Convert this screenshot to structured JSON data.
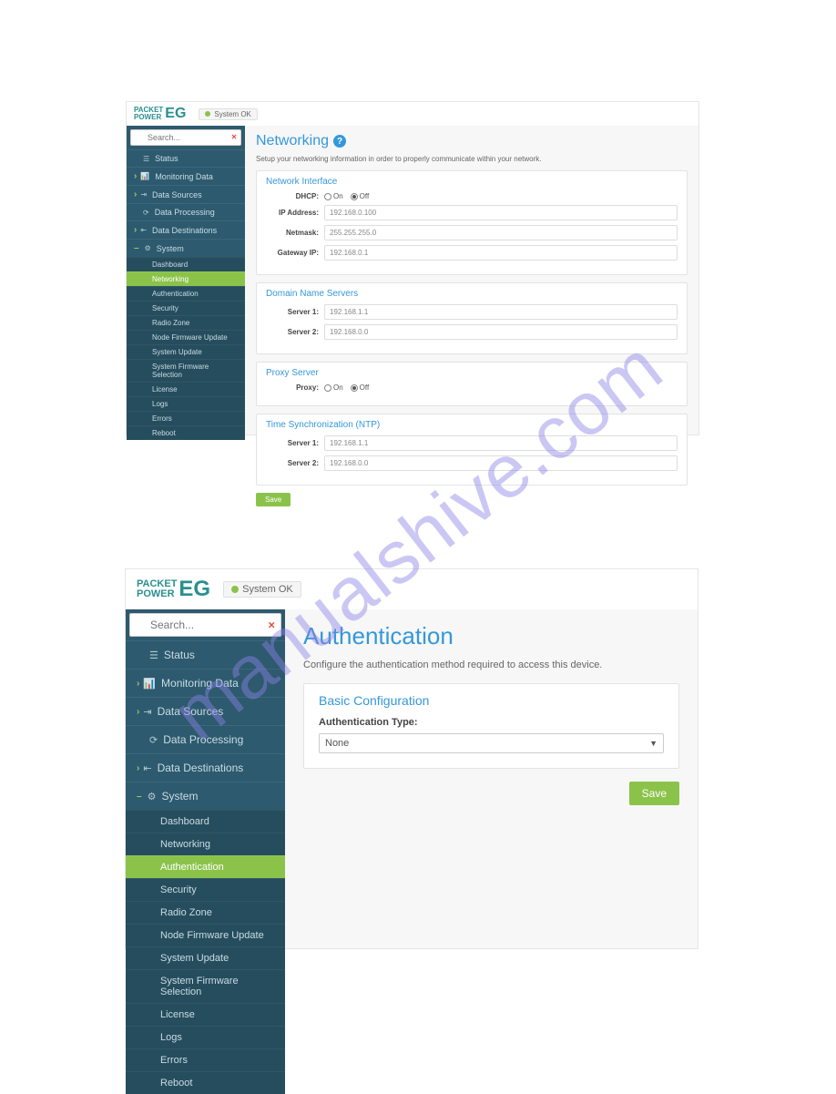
{
  "watermark": "manualshive.com",
  "brand": {
    "line1": "PACKET",
    "line2": "POWER",
    "suffix": "EG"
  },
  "status_badge": "System OK",
  "search": {
    "placeholder": "Search..."
  },
  "nav": [
    {
      "icon": "☰",
      "label": "Status",
      "caret": false
    },
    {
      "icon": "📊",
      "label": "Monitoring Data",
      "caret": true
    },
    {
      "icon": "⇥",
      "label": "Data Sources",
      "caret": true
    },
    {
      "icon": "⟳",
      "label": "Data Processing",
      "caret": false
    },
    {
      "icon": "⇤",
      "label": "Data Destinations",
      "caret": true
    },
    {
      "icon": "⚙",
      "label": "System",
      "caret": true,
      "expanded": true
    }
  ],
  "system_sub": [
    "Dashboard",
    "Networking",
    "Authentication",
    "Security",
    "Radio Zone",
    "Node Firmware Update",
    "System Update",
    "System Firmware Selection",
    "License",
    "Logs",
    "Errors",
    "Reboot"
  ],
  "screenshot1": {
    "title": "Networking",
    "desc": "Setup your networking information in order to properly communicate within your network.",
    "panels": {
      "network_interface": {
        "title": "Network Interface",
        "dhcp_label": "DHCP:",
        "on": "On",
        "off": "Off",
        "ip_label": "IP Address:",
        "ip_val": "192.168.0.100",
        "mask_label": "Netmask:",
        "mask_val": "255.255.255.0",
        "gw_label": "Gateway IP:",
        "gw_val": "192.168.0.1"
      },
      "dns": {
        "title": "Domain Name Servers",
        "s1_label": "Server 1:",
        "s1_val": "192.168.1.1",
        "s2_label": "Server 2:",
        "s2_val": "192.168.0.0"
      },
      "proxy": {
        "title": "Proxy Server",
        "label": "Proxy:",
        "on": "On",
        "off": "Off"
      },
      "ntp": {
        "title": "Time Synchronization (NTP)",
        "s1_label": "Server 1:",
        "s1_val": "192.168.1.1",
        "s2_label": "Server 2:",
        "s2_val": "192.168.0.0"
      }
    },
    "save": "Save",
    "active_sub": "Networking"
  },
  "screenshot2": {
    "title": "Authentication",
    "desc": "Configure the authentication method required to access this device.",
    "panel": {
      "title": "Basic Configuration",
      "auth_type_label": "Authentication Type:",
      "auth_type_value": "None"
    },
    "save": "Save",
    "active_sub": "Authentication"
  }
}
